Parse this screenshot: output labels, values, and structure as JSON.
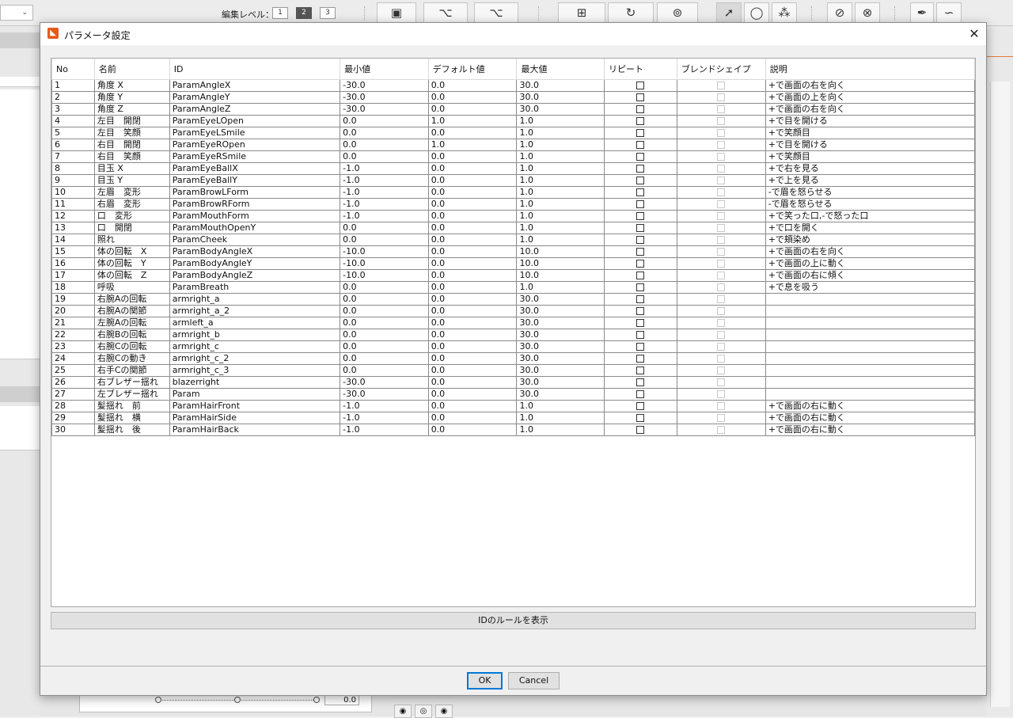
{
  "app": {
    "edit_level_label": "編集レベル：",
    "edit_levels": [
      "1",
      "2",
      "3"
    ],
    "slider_value": "0.0"
  },
  "dialog": {
    "title": "パラメータ設定",
    "close_glyph": "✕",
    "columns": [
      "No",
      "名前",
      "ID",
      "最小値",
      "デフォルト値",
      "最大値",
      "リピート",
      "ブレンドシェイプ",
      "説明"
    ],
    "rows": [
      {
        "no": "1",
        "name": "角度 X",
        "id": "ParamAngleX",
        "min": "-30.0",
        "def": "0.0",
        "max": "30.0",
        "desc": "+で画面の右を向く"
      },
      {
        "no": "2",
        "name": "角度 Y",
        "id": "ParamAngleY",
        "min": "-30.0",
        "def": "0.0",
        "max": "30.0",
        "desc": "+で画面の上を向く"
      },
      {
        "no": "3",
        "name": "角度 Z",
        "id": "ParamAngleZ",
        "min": "-30.0",
        "def": "0.0",
        "max": "30.0",
        "desc": "+で画面の右を向く"
      },
      {
        "no": "4",
        "name": "左目　開閉",
        "id": "ParamEyeLOpen",
        "min": "0.0",
        "def": "1.0",
        "max": "1.0",
        "desc": "+で目を開ける"
      },
      {
        "no": "5",
        "name": "左目　笑顔",
        "id": "ParamEyeLSmile",
        "min": "0.0",
        "def": "0.0",
        "max": "1.0",
        "desc": "+で笑顔目"
      },
      {
        "no": "6",
        "name": "右目　開閉",
        "id": "ParamEyeROpen",
        "min": "0.0",
        "def": "1.0",
        "max": "1.0",
        "desc": "+で目を開ける"
      },
      {
        "no": "7",
        "name": "右目　笑顔",
        "id": "ParamEyeRSmile",
        "min": "0.0",
        "def": "0.0",
        "max": "1.0",
        "desc": "+で笑顔目"
      },
      {
        "no": "8",
        "name": "目玉 X",
        "id": "ParamEyeBallX",
        "min": "-1.0",
        "def": "0.0",
        "max": "1.0",
        "desc": "+で右を見る"
      },
      {
        "no": "9",
        "name": "目玉 Y",
        "id": "ParamEyeBallY",
        "min": "-1.0",
        "def": "0.0",
        "max": "1.0",
        "desc": "+で上を見る"
      },
      {
        "no": "10",
        "name": "左眉　変形",
        "id": "ParamBrowLForm",
        "min": "-1.0",
        "def": "0.0",
        "max": "1.0",
        "desc": "-で眉を怒らせる"
      },
      {
        "no": "11",
        "name": "右眉　変形",
        "id": "ParamBrowRForm",
        "min": "-1.0",
        "def": "0.0",
        "max": "1.0",
        "desc": "-で眉を怒らせる"
      },
      {
        "no": "12",
        "name": "口　変形",
        "id": "ParamMouthForm",
        "min": "-1.0",
        "def": "0.0",
        "max": "1.0",
        "desc": "+で笑った口,-で怒った口"
      },
      {
        "no": "13",
        "name": "口　開閉",
        "id": "ParamMouthOpenY",
        "min": "0.0",
        "def": "0.0",
        "max": "1.0",
        "desc": "+で口を開く"
      },
      {
        "no": "14",
        "name": "照れ",
        "id": "ParamCheek",
        "min": "0.0",
        "def": "0.0",
        "max": "1.0",
        "desc": "+で頬染め"
      },
      {
        "no": "15",
        "name": "体の回転　X",
        "id": "ParamBodyAngleX",
        "min": "-10.0",
        "def": "0.0",
        "max": "10.0",
        "desc": "+で画面の右を向く"
      },
      {
        "no": "16",
        "name": "体の回転　Y",
        "id": "ParamBodyAngleY",
        "min": "-10.0",
        "def": "0.0",
        "max": "10.0",
        "desc": "+で画面の上に動く"
      },
      {
        "no": "17",
        "name": "体の回転　Z",
        "id": "ParamBodyAngleZ",
        "min": "-10.0",
        "def": "0.0",
        "max": "10.0",
        "desc": "+で画面の右に傾く"
      },
      {
        "no": "18",
        "name": "呼吸",
        "id": "ParamBreath",
        "min": "0.0",
        "def": "0.0",
        "max": "1.0",
        "desc": "+で息を吸う"
      },
      {
        "no": "19",
        "name": "右腕Aの回転",
        "id": "armright_a",
        "min": "0.0",
        "def": "0.0",
        "max": "30.0",
        "desc": ""
      },
      {
        "no": "20",
        "name": "右腕Aの関節",
        "id": "armright_a_2",
        "min": "0.0",
        "def": "0.0",
        "max": "30.0",
        "desc": ""
      },
      {
        "no": "21",
        "name": "左腕Aの回転",
        "id": "armleft_a",
        "min": "0.0",
        "def": "0.0",
        "max": "30.0",
        "desc": ""
      },
      {
        "no": "22",
        "name": "右腕Bの回転",
        "id": "armright_b",
        "min": "0.0",
        "def": "0.0",
        "max": "30.0",
        "desc": ""
      },
      {
        "no": "23",
        "name": "右腕Cの回転",
        "id": "armright_c",
        "min": "0.0",
        "def": "0.0",
        "max": "30.0",
        "desc": ""
      },
      {
        "no": "24",
        "name": "右腕Cの動き",
        "id": "armright_c_2",
        "min": "0.0",
        "def": "0.0",
        "max": "30.0",
        "desc": ""
      },
      {
        "no": "25",
        "name": "右手Cの関節",
        "id": "armright_c_3",
        "min": "0.0",
        "def": "0.0",
        "max": "30.0",
        "desc": ""
      },
      {
        "no": "26",
        "name": "右ブレザー揺れ",
        "id": "blazerright",
        "min": "-30.0",
        "def": "0.0",
        "max": "30.0",
        "desc": ""
      },
      {
        "no": "27",
        "name": "左ブレザー揺れ",
        "id": "Param",
        "min": "-30.0",
        "def": "0.0",
        "max": "30.0",
        "desc": ""
      },
      {
        "no": "28",
        "name": "髪揺れ　前",
        "id": "ParamHairFront",
        "min": "-1.0",
        "def": "0.0",
        "max": "1.0",
        "desc": "+で画面の右に動く"
      },
      {
        "no": "29",
        "name": "髪揺れ　横",
        "id": "ParamHairSide",
        "min": "-1.0",
        "def": "0.0",
        "max": "1.0",
        "desc": "+で画面の右に動く"
      },
      {
        "no": "30",
        "name": "髪揺れ　後",
        "id": "ParamHairBack",
        "min": "-1.0",
        "def": "0.0",
        "max": "1.0",
        "desc": "+で画面の右に動く"
      }
    ],
    "rule_button": "IDのルールを表示",
    "ok_label": "OK",
    "cancel_label": "Cancel"
  }
}
